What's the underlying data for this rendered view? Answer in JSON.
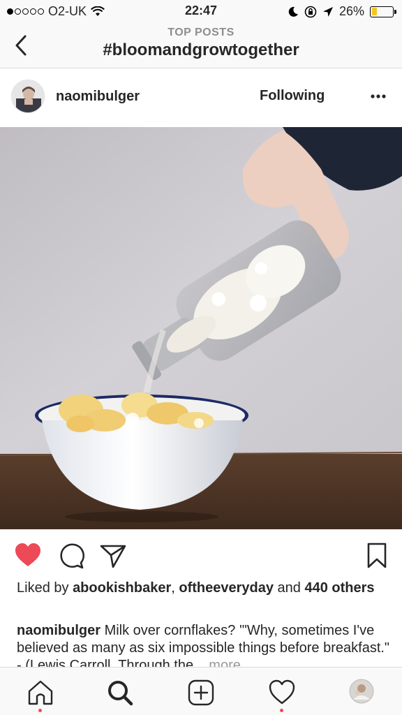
{
  "status_bar": {
    "carrier": "O2-UK",
    "time": "22:47",
    "battery_percent": "26%",
    "battery_level": 0.26,
    "battery_color": "#f7c522"
  },
  "header": {
    "subtitle": "TOP POSTS",
    "title": "#bloomandgrowtogether",
    "back_icon": "chevron-left-icon"
  },
  "post": {
    "username": "naomibulger",
    "follow_label": "Following",
    "more_icon": "ellipsis-icon",
    "liked_prefix": "Liked by ",
    "liked_user_1": "abookishbaker",
    "liked_sep": ", ",
    "liked_user_2": "oftheeveryday",
    "liked_and": " and ",
    "liked_others": "440 others",
    "caption_user": "naomibulger",
    "caption_text": " Milk over cornflakes? '\"Why, sometimes I've believed as many as six impossible things before breakfast.\" - (Lewis Carroll, Through the... ",
    "caption_more": "more",
    "liked": true,
    "like_color": "#ed4956"
  },
  "tabbar": {
    "tabs": [
      "home-icon",
      "search-icon",
      "add-post-icon",
      "activity-heart-icon",
      "profile-avatar"
    ],
    "notification_color": "#ed4956"
  }
}
